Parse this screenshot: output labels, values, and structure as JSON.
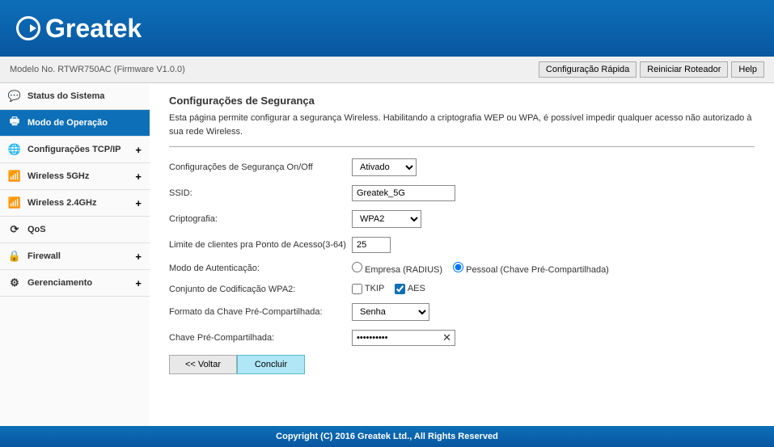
{
  "brand": "Greatek",
  "model_line": "Modelo No. RTWR750AC (Firmware V1.0.0)",
  "header_buttons": {
    "quick": "Configuração Rápida",
    "reboot": "Reiniciar Roteador",
    "help": "Help"
  },
  "sidebar": {
    "items": [
      {
        "label": "Status do Sistema"
      },
      {
        "label": "Modo de Operação"
      },
      {
        "label": "Configurações TCP/IP"
      },
      {
        "label": "Wireless 5GHz"
      },
      {
        "label": "Wireless 2.4GHz"
      },
      {
        "label": "QoS"
      },
      {
        "label": "Firewall"
      },
      {
        "label": "Gerenciamento"
      }
    ]
  },
  "page": {
    "title": "Configurações de Segurança",
    "desc": "Esta página permite configurar a segurança Wireless. Habilitando a criptografia WEP ou WPA, é possível impedir qualquer acesso não autorizado à sua rede Wireless."
  },
  "form": {
    "onoff_label": "Configurações de Segurança On/Off",
    "onoff_value": "Ativado",
    "ssid_label": "SSID:",
    "ssid_value": "Greatek_5G",
    "cipher_label": "Criptografia:",
    "cipher_value": "WPA2",
    "limit_label": "Limite de clientes pra Ponto de Acesso(3-64)",
    "limit_value": "25",
    "auth_label": "Modo de Autenticação:",
    "auth_radius": "Empresa (RADIUS)",
    "auth_psk": "Pessoal (Chave Pré-Compartilhada)",
    "wpa2set_label": "Conjunto de Codificação WPA2:",
    "tkip_label": "TKIP",
    "aes_label": "AES",
    "keyfmt_label": "Formato da Chave Pré-Compartilhada:",
    "keyfmt_value": "Senha",
    "key_label": "Chave Pré-Compartilhada:",
    "key_value": "••••••••••",
    "back_btn": "<< Voltar",
    "submit_btn": "Concluir"
  },
  "footer": "Copyright (C) 2016 Greatek Ltd., All Rights Reserved"
}
